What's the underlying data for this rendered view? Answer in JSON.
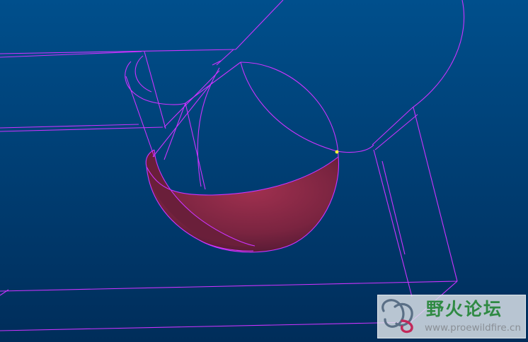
{
  "scene": {
    "background_top": "#004f8c",
    "background_bottom": "#002d5a",
    "edge_color": "#cc33ff",
    "surface_color": "#8a2a48",
    "highlight_color": "#ffff33"
  },
  "watermark": {
    "title": "野火论坛",
    "url": "www.proewildfire.cn",
    "title_color": "#2f8a43",
    "logo_icon": "flame-swirl-logo"
  }
}
